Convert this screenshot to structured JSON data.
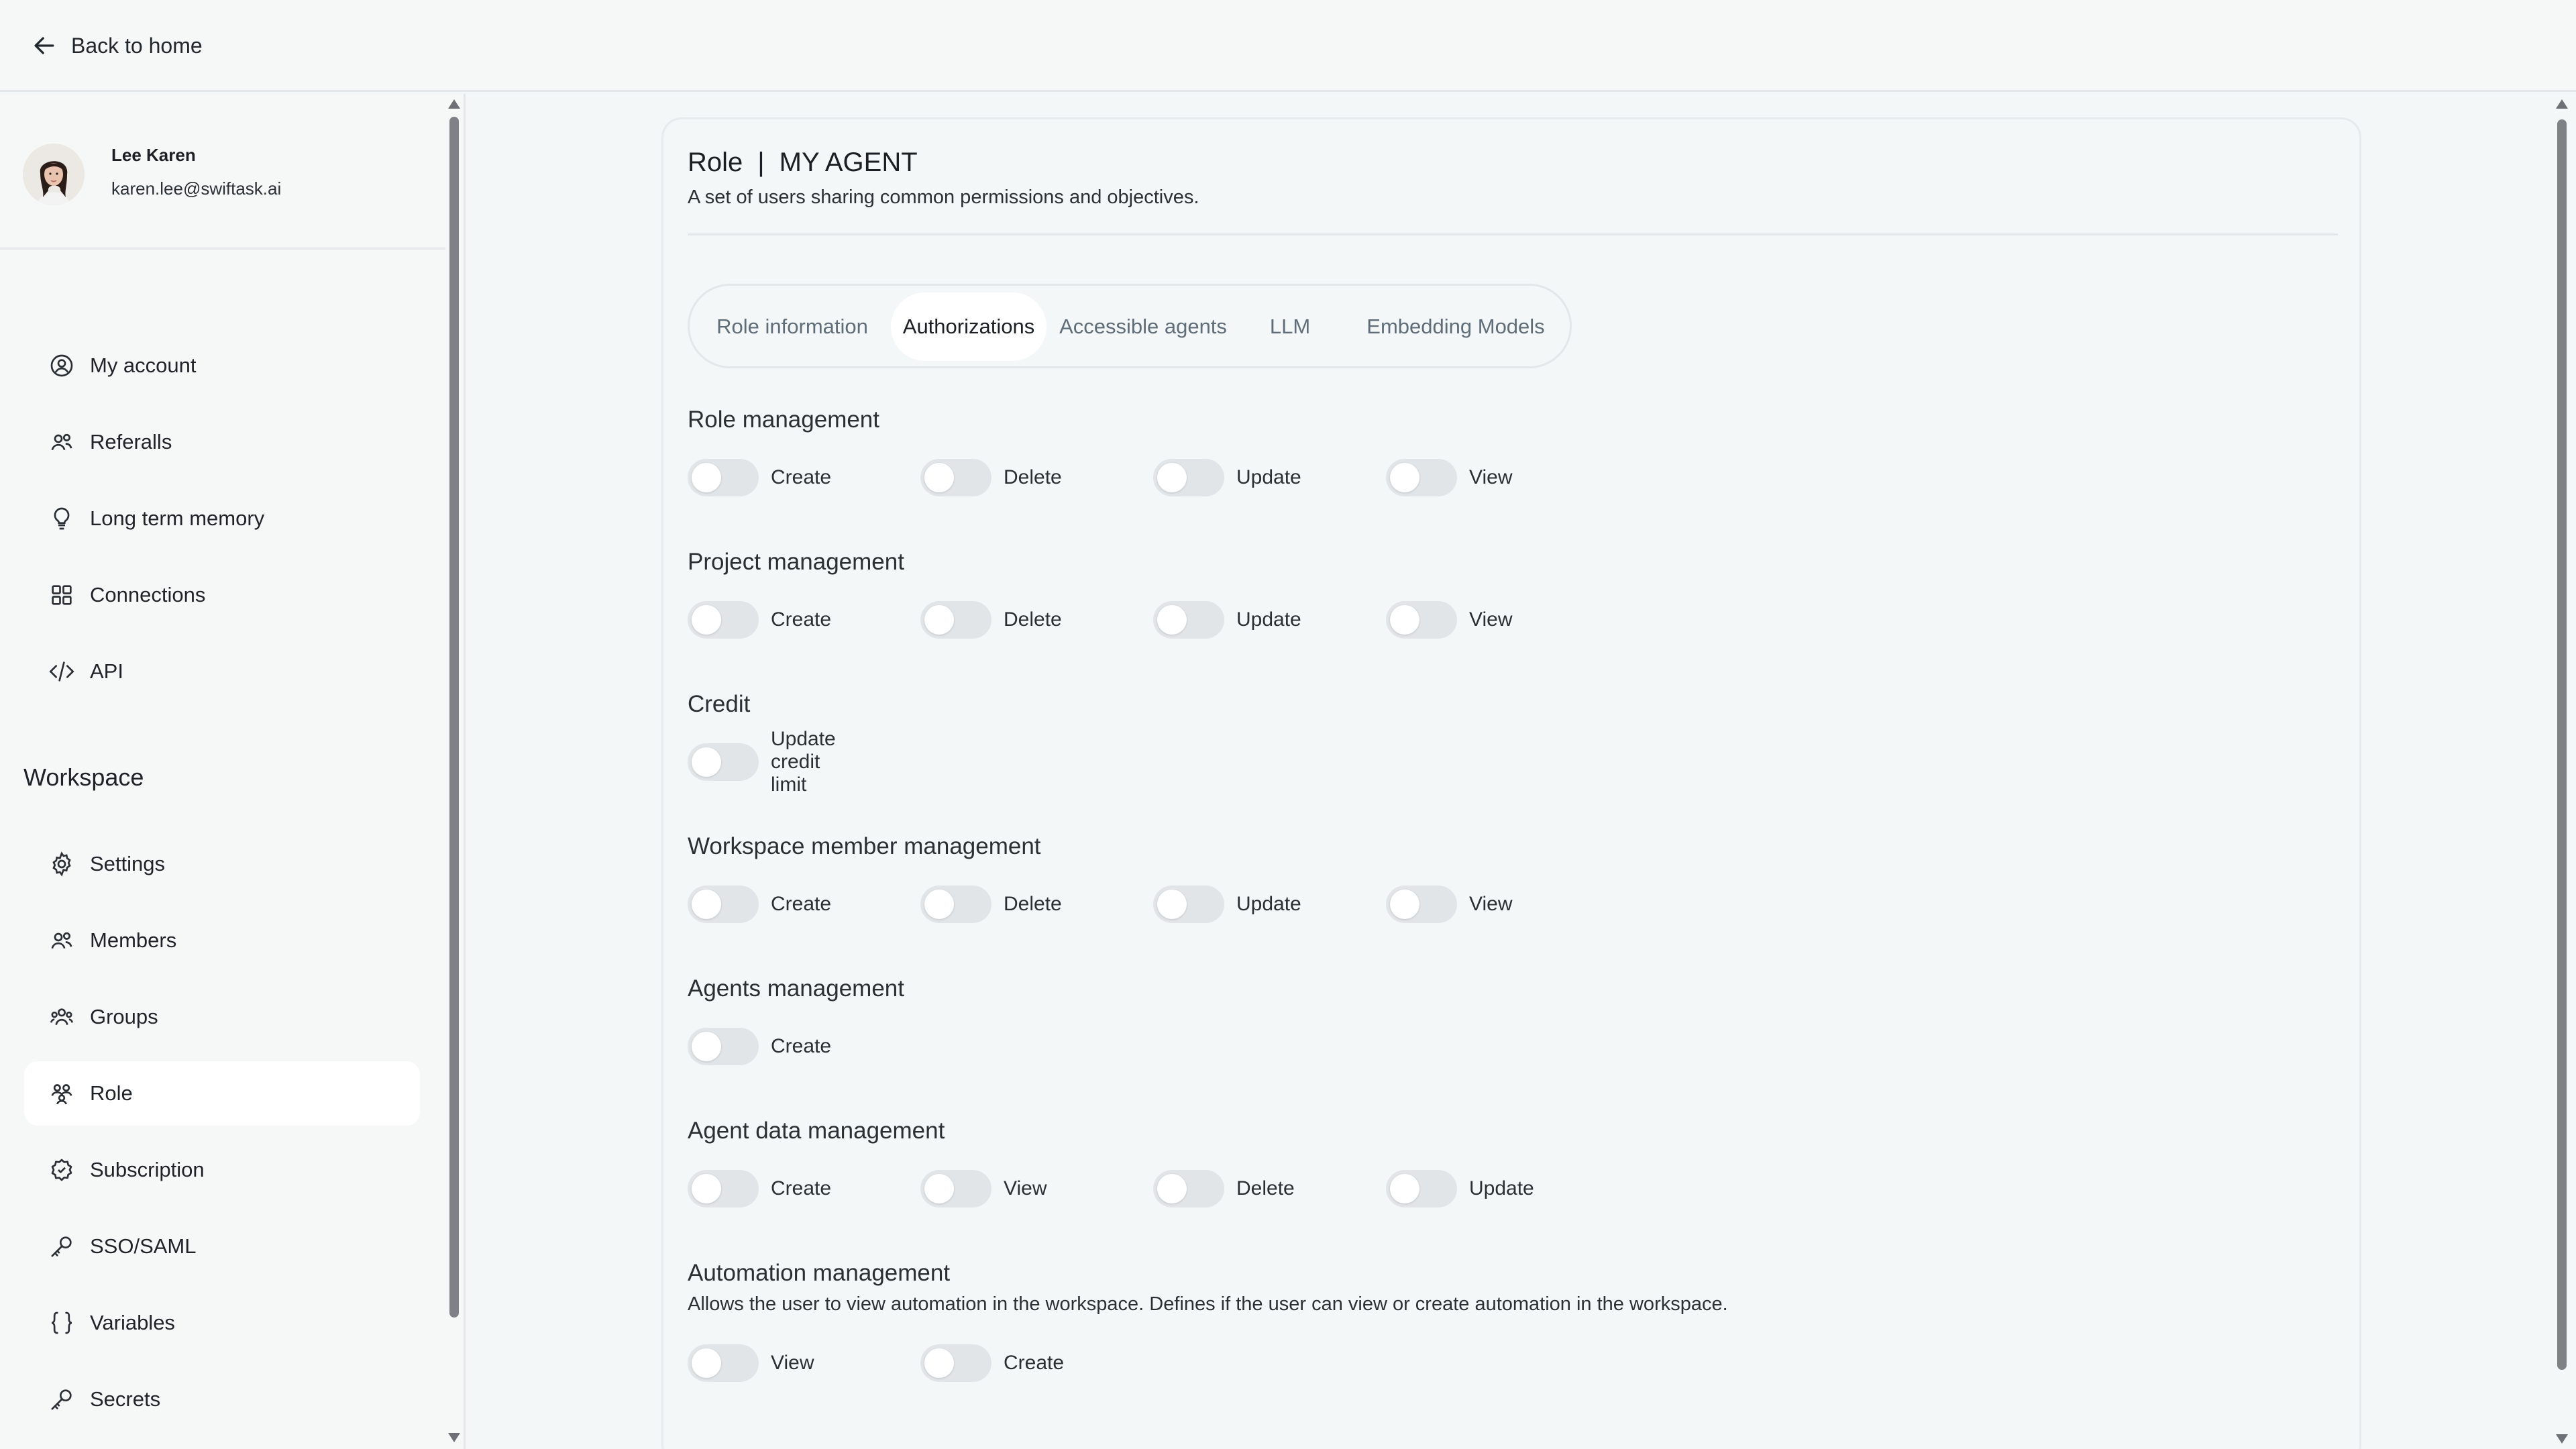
{
  "topbar": {
    "back_label": "Back to home"
  },
  "profile": {
    "name": "Lee Karen",
    "email": "karen.lee@swiftask.ai"
  },
  "nav": {
    "account_items": [
      {
        "label": "My account",
        "icon": "user-circle-icon"
      },
      {
        "label": "Referalls",
        "icon": "users-icon"
      },
      {
        "label": "Long term memory",
        "icon": "lightbulb-icon"
      },
      {
        "label": "Connections",
        "icon": "grid-icon"
      },
      {
        "label": "API",
        "icon": "code-icon"
      }
    ],
    "workspace_title": "Workspace",
    "workspace_items": [
      {
        "label": "Settings",
        "icon": "gear-icon"
      },
      {
        "label": "Members",
        "icon": "users-icon"
      },
      {
        "label": "Groups",
        "icon": "users-group-icon"
      },
      {
        "label": "Role",
        "icon": "role-icon",
        "active": true
      },
      {
        "label": "Subscription",
        "icon": "badge-icon"
      },
      {
        "label": "SSO/SAML",
        "icon": "key-icon"
      },
      {
        "label": "Variables",
        "icon": "braces-icon"
      },
      {
        "label": "Secrets",
        "icon": "key-icon"
      }
    ]
  },
  "card": {
    "title_prefix": "Role",
    "title_sep": "|",
    "title_name": "MY AGENT",
    "subtitle": "A set of users sharing common permissions and objectives."
  },
  "tabs": [
    {
      "label": "Role information",
      "active": false
    },
    {
      "label": "Authorizations",
      "active": true
    },
    {
      "label": "Accessible agents",
      "active": false
    },
    {
      "label": "LLM",
      "active": false
    },
    {
      "label": "Embedding Models",
      "active": false
    }
  ],
  "groups": [
    {
      "title": "Role management",
      "toggles": [
        "Create",
        "Delete",
        "Update",
        "View"
      ]
    },
    {
      "title": "Project management",
      "toggles": [
        "Create",
        "Delete",
        "Update",
        "View"
      ]
    },
    {
      "title": "Credit",
      "toggles": [
        "Update credit limit"
      ]
    },
    {
      "title": "Workspace member management",
      "toggles": [
        "Create",
        "Delete",
        "Update",
        "View"
      ]
    },
    {
      "title": "Agents management",
      "toggles": [
        "Create"
      ]
    },
    {
      "title": "Agent data management",
      "toggles": [
        "Create",
        "View",
        "Delete",
        "Update"
      ]
    },
    {
      "title": "Automation management",
      "description": "Allows the user to view automation in the workspace. Defines if the user can view or create automation in the workspace.",
      "toggles": [
        "View",
        "Create"
      ]
    }
  ],
  "toggle_state": "off"
}
